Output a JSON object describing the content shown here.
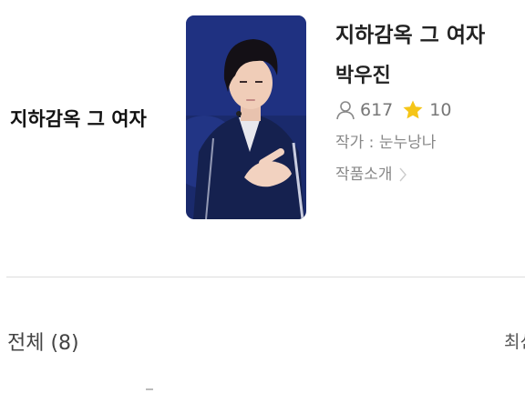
{
  "side_title": "지하감옥 그 여자",
  "work": {
    "title": "지하감옥 그 여자",
    "author": "박우진",
    "views": "617",
    "rating": "10",
    "writer": "작가 : 눈누낭나",
    "intro_label": "작품소개"
  },
  "list": {
    "header": "전체 (8)",
    "sort_label": "최신"
  },
  "colors": {
    "star": "#f5c518",
    "muted_text": "#888888",
    "divider": "#dddddd"
  },
  "icons": {
    "views": "person-icon",
    "rating": "star-icon",
    "intro": "chevron-right-icon"
  }
}
